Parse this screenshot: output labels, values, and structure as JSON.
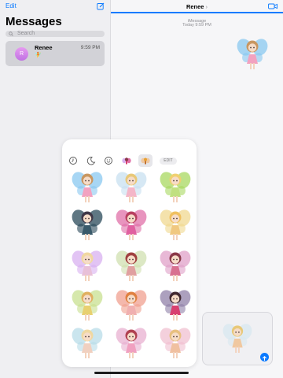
{
  "sidebar": {
    "edit_label": "Edit",
    "title": "Messages",
    "search_placeholder": "Search",
    "conversations": [
      {
        "initial": "R",
        "name": "Renee",
        "time": "9:59 PM",
        "preview": "🧚"
      }
    ]
  },
  "chat": {
    "contact_name": "Renee",
    "chevron": "›",
    "service_label": "iMessage",
    "timestamp": "Today 9:59 PM"
  },
  "sticker_panel": {
    "tabs": [
      "recents-icon",
      "sleep-icon",
      "emoji-icon",
      "sticker-pack-fairy-1-icon",
      "sticker-pack-fairy-2-icon"
    ],
    "selected_tab": 4,
    "edit_label": "EDIT",
    "stickers": [
      {
        "name": "fairy-blue-wings",
        "hair": "#c89660",
        "wing": "#8ac8f0",
        "dress": "#f2a2c0"
      },
      {
        "name": "fairy-blonde-pink",
        "hair": "#e8c878",
        "wing": "#c8e0f0",
        "dress": "#f4b6c8"
      },
      {
        "name": "fairy-green-lime",
        "hair": "#f0d070",
        "wing": "#a8d860",
        "dress": "#c0e080"
      },
      {
        "name": "fairy-dark-teal",
        "hair": "#403848",
        "wing": "#2a4a5a",
        "dress": "#3a5a6a"
      },
      {
        "name": "fairy-magenta",
        "hair": "#b84060",
        "wing": "#e070a8",
        "dress": "#e060a0"
      },
      {
        "name": "fairy-yellow",
        "hair": "#f0c060",
        "wing": "#f0d890",
        "dress": "#f0c880"
      },
      {
        "name": "fairy-lavender",
        "hair": "#f0d8a0",
        "wing": "#d8b0f0",
        "dress": "#e8c0d8"
      },
      {
        "name": "fairy-red-green",
        "hair": "#a04040",
        "wing": "#d0e0b0",
        "dress": "#e0a0a0"
      },
      {
        "name": "fairy-pink-purple",
        "hair": "#8a3848",
        "wing": "#e0a0c8",
        "dress": "#d87090"
      },
      {
        "name": "fairy-meadow",
        "hair": "#e0b060",
        "wing": "#c8e090",
        "dress": "#e8d070"
      },
      {
        "name": "fairy-orange",
        "hair": "#e08040",
        "wing": "#f0a090",
        "dress": "#f0b0b0"
      },
      {
        "name": "fairy-dark-pink",
        "hair": "#402830",
        "wing": "#9080a8",
        "dress": "#d84070"
      },
      {
        "name": "fairy-pale-blue",
        "hair": "#f0d8a0",
        "wing": "#b8dce8",
        "dress": "#f0d0c0"
      },
      {
        "name": "fairy-rose",
        "hair": "#b04050",
        "wing": "#e8b0d0",
        "dress": "#f0a0c0"
      },
      {
        "name": "fairy-peach",
        "hair": "#e8c080",
        "wing": "#f0c0d0",
        "dress": "#f0c0a0"
      }
    ]
  },
  "sent_sticker": {
    "hair": "#c89660",
    "wing": "#8ac8f0",
    "dress": "#f2a2c0"
  },
  "preview_sticker": {
    "hair": "#e8c878",
    "wing": "#d8e8f0",
    "dress": "#f0c8a0"
  },
  "colors": {
    "accent": "#0a7aff",
    "avatar": "#c071e3"
  }
}
